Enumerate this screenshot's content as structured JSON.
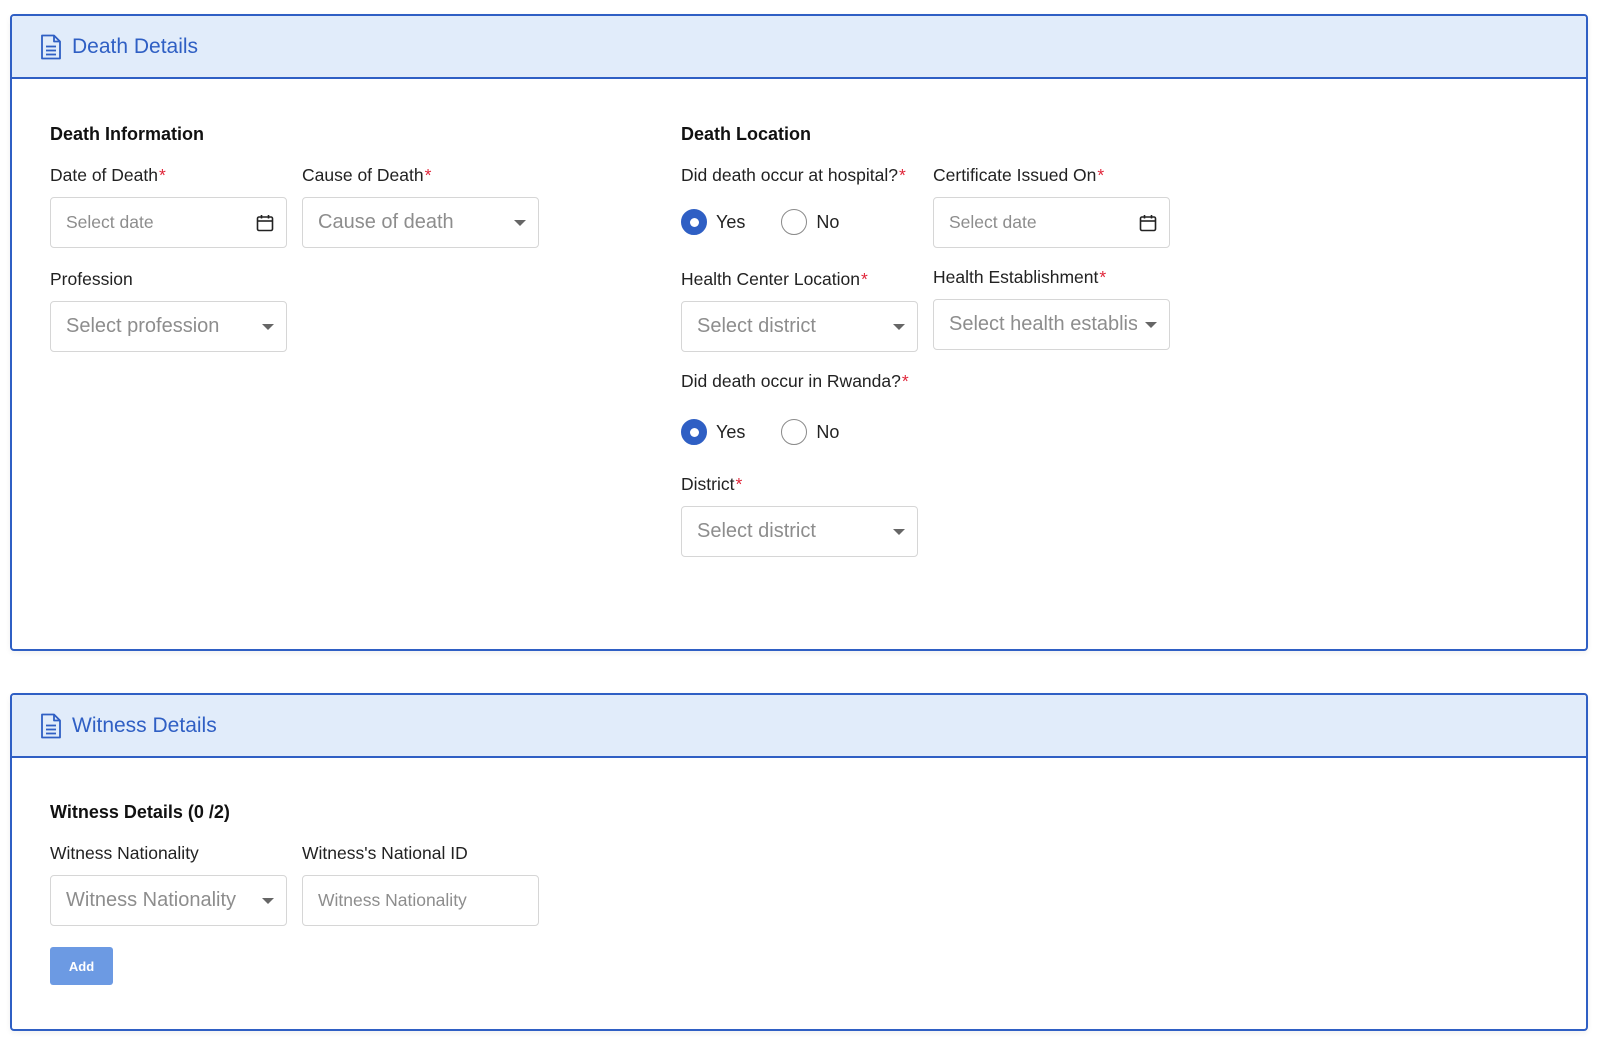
{
  "death_card": {
    "header_title": "Death Details",
    "death_information": {
      "title": "Death Information",
      "date_of_death": {
        "label": "Date of Death",
        "placeholder": "Select date"
      },
      "cause_of_death": {
        "label": "Cause of Death",
        "placeholder": "Cause of death"
      },
      "profession": {
        "label": "Profession",
        "placeholder": "Select profession"
      }
    },
    "death_location": {
      "title": "Death Location",
      "hospital_question": {
        "label": "Did death occur at hospital?",
        "yes": "Yes",
        "no": "No",
        "selected": "Yes"
      },
      "certificate_issued_on": {
        "label": "Certificate Issued On",
        "placeholder": "Select date"
      },
      "health_center_location": {
        "label": "Health Center Location",
        "placeholder": "Select district"
      },
      "health_establishment": {
        "label": "Health Establishment",
        "placeholder": "Select health establis"
      },
      "rwanda_question": {
        "label": "Did death occur in Rwanda?",
        "yes": "Yes",
        "no": "No",
        "selected": "Yes"
      },
      "district": {
        "label": "District",
        "placeholder": "Select district"
      }
    }
  },
  "witness_card": {
    "header_title": "Witness Details",
    "section_title": "Witness Details (0 /2)",
    "witness_nationality": {
      "label": "Witness Nationality",
      "placeholder": "Witness Nationality"
    },
    "witness_national_id": {
      "label": "Witness's National ID",
      "placeholder": "Witness Nationality"
    },
    "add_button": "Add"
  },
  "required_marker": "*",
  "colors": {
    "accent": "#2f5fc4",
    "header_bg": "#e1ecfa",
    "required": "#e0263a",
    "add_button": "#6c9ae3"
  },
  "icons": {
    "header": "document-icon",
    "date": "calendar-icon",
    "dropdown": "chevron-down-icon"
  }
}
